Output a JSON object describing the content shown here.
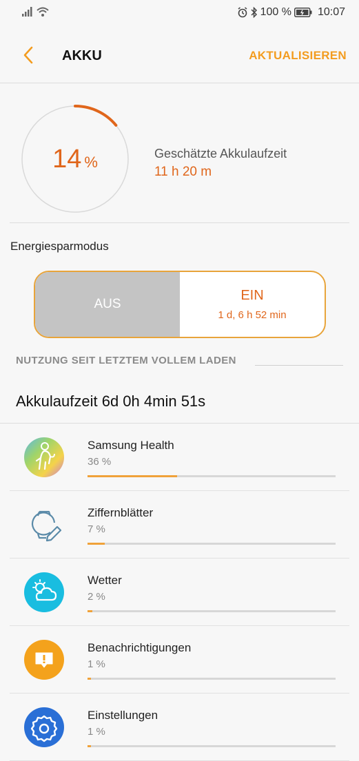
{
  "status_bar": {
    "battery_text": "100 %",
    "time": "10:07"
  },
  "header": {
    "title": "AKKU",
    "refresh_label": "AKTUALISIEREN"
  },
  "battery": {
    "percent": "14",
    "percent_unit": "%",
    "level_fraction": 0.14,
    "estimate_label": "Geschätzte Akkulaufzeit",
    "estimate_value": "11 h 20 m"
  },
  "power_saving": {
    "label": "Energiesparmodus",
    "off_label": "AUS",
    "on_label": "EIN",
    "on_duration": "1 d, 6 h 52 min",
    "selected": "on"
  },
  "usage": {
    "section_title": "NUTZUNG SEIT LETZTEM VOLLEM LADEN",
    "runtime": "Akkulaufzeit 6d 0h 4min 51s",
    "apps": [
      {
        "name": "Samsung Health",
        "percent": "36 %",
        "fraction": 0.36,
        "icon": "samsung-health-icon"
      },
      {
        "name": "Ziffernblätter",
        "percent": "7 %",
        "fraction": 0.07,
        "icon": "watch-faces-icon"
      },
      {
        "name": "Wetter",
        "percent": "2 %",
        "fraction": 0.02,
        "icon": "weather-icon"
      },
      {
        "name": "Benachrichtigungen",
        "percent": "1 %",
        "fraction": 0.01,
        "icon": "notifications-icon"
      },
      {
        "name": "Einstellungen",
        "percent": "1 %",
        "fraction": 0.01,
        "icon": "settings-gear-icon"
      }
    ]
  },
  "colors": {
    "accent_orange": "#e0661b",
    "accent_amber": "#f39c1f",
    "bar_fill": "#f0a23a",
    "toggle_off_bg": "#c4c4c4"
  }
}
